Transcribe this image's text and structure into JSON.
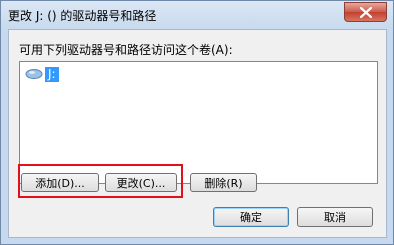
{
  "window": {
    "title": "更改 J: () 的驱动器号和路径"
  },
  "dialog": {
    "prompt": "可用下列驱动器号和路径访问这个卷(A):",
    "items": [
      {
        "label": "J:",
        "icon": "drive-icon",
        "selected": true
      }
    ],
    "buttons": {
      "add": "添加(D)...",
      "change": "更改(C)...",
      "delete": "删除(R)",
      "ok": "确定",
      "cancel": "取消"
    }
  },
  "colors": {
    "highlight_border": "#e0101e",
    "selection": "#3399ff",
    "close_button": "#c2412f"
  }
}
